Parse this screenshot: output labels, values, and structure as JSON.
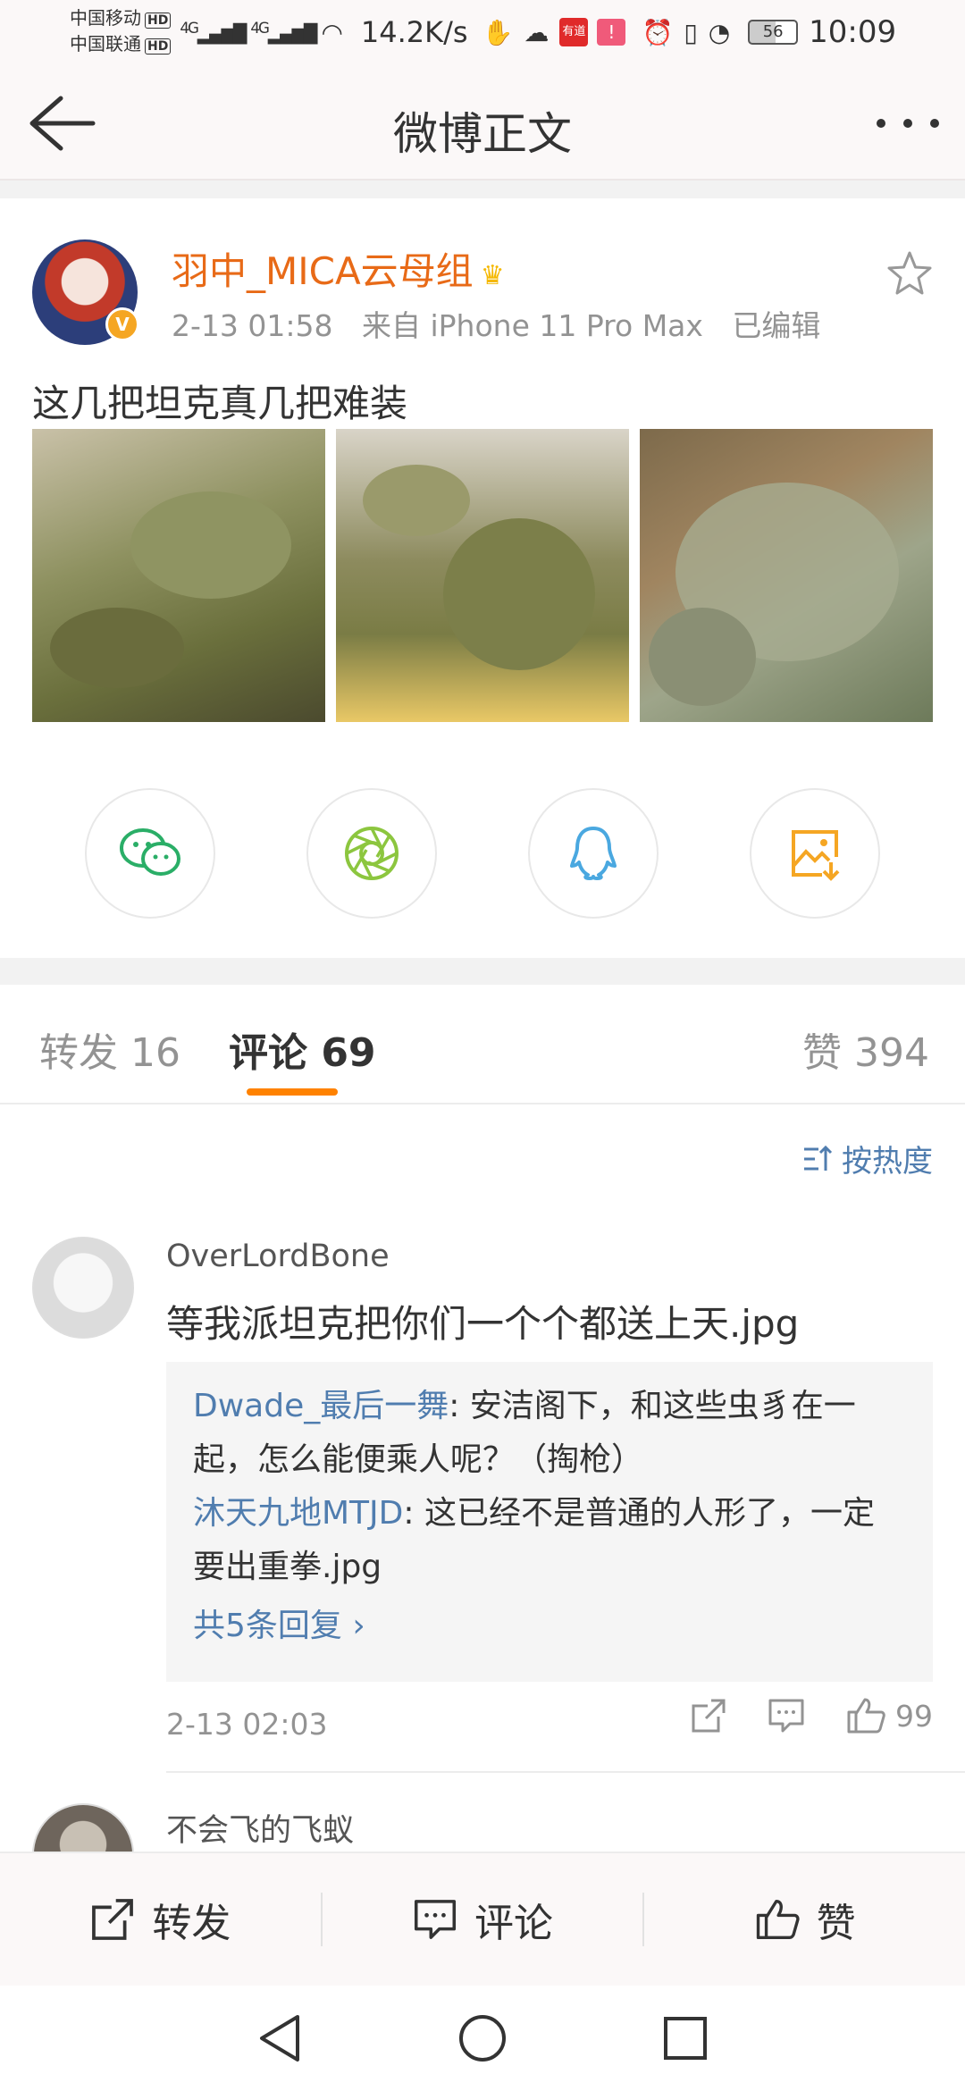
{
  "status_bar": {
    "carrier1": "中国移动",
    "carrier2": "中国联通",
    "hd": "HD",
    "net1": "4G",
    "net2": "4G",
    "speed": "14.2K/s",
    "app_badge": "有道",
    "battery": "56",
    "time": "10:09"
  },
  "nav": {
    "title": "微博正文"
  },
  "post": {
    "username": "羽中_MICA云母组",
    "verified": "V",
    "time": "2-13 01:58",
    "source": "来自 iPhone 11 Pro Max",
    "edited": "已编辑",
    "text": "这几把坦克真几把难装"
  },
  "share": [
    "wechat-icon",
    "moments-icon",
    "qq-icon",
    "save-image-icon"
  ],
  "tabs": {
    "repost": "转发 16",
    "comments": "评论 69",
    "likes": "赞 394"
  },
  "sort": {
    "label": "按热度"
  },
  "comments": [
    {
      "name": "OverLordBone",
      "text": "等我派坦克把你们一个个都送上天.jpg",
      "replies": [
        {
          "user": "Dwade_最后一舞",
          "text": ": 安洁阁下，和这些虫豸在一起，怎么能便乘人呢？（掏枪）"
        },
        {
          "user": "沐天九地MTJD",
          "text": ": 这已经不是普通的人形了，一定要出重拳.jpg"
        }
      ],
      "more": "共5条回复 ›",
      "time": "2-13 02:03",
      "likes": "99"
    },
    {
      "name": "不会飞的飞蚁"
    }
  ],
  "toolbar": {
    "repost": "转发",
    "comment": "评论",
    "like": "赞"
  },
  "colors": {
    "accent": "#ff8200",
    "username": "#e86a17",
    "link": "#507daf"
  }
}
